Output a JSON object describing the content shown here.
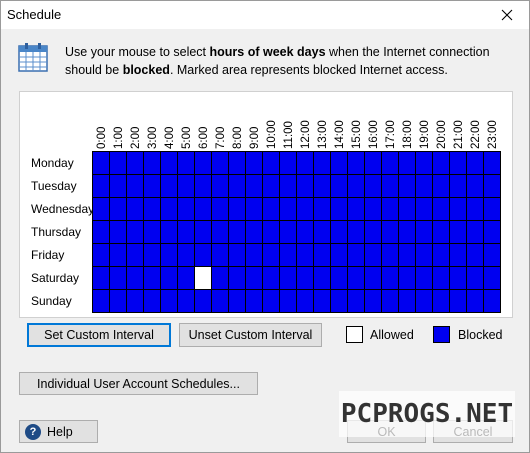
{
  "window": {
    "title": "Schedule"
  },
  "info": {
    "part1": "Use your mouse to select ",
    "bold1": "hours of week days",
    "part2": " when the Internet connection should be ",
    "bold2": "blocked",
    "part3": ". Marked area represents blocked Internet access."
  },
  "hours": [
    "0:00",
    "1:00",
    "2:00",
    "3:00",
    "4:00",
    "5:00",
    "6:00",
    "7:00",
    "8:00",
    "9:00",
    "10:00",
    "11:00",
    "12:00",
    "13:00",
    "14:00",
    "15:00",
    "16:00",
    "17:00",
    "18:00",
    "19:00",
    "20:00",
    "21:00",
    "22:00",
    "23:00"
  ],
  "days": [
    "Monday",
    "Tuesday",
    "Wednesday",
    "Thursday",
    "Friday",
    "Saturday",
    "Sunday"
  ],
  "schedule": {
    "blocked_color": "#0000f0",
    "allowed_color": "#ffffff",
    "allowed_cells": [
      [
        5,
        6
      ]
    ]
  },
  "buttons": {
    "set_custom": "Set Custom Interval",
    "unset_custom": "Unset Custom Interval",
    "individual": "Individual User Account Schedules...",
    "help": "Help",
    "ok": "OK",
    "cancel": "Cancel"
  },
  "legend": {
    "allowed": "Allowed",
    "blocked": "Blocked"
  },
  "watermark": "PCPROGS.NET"
}
